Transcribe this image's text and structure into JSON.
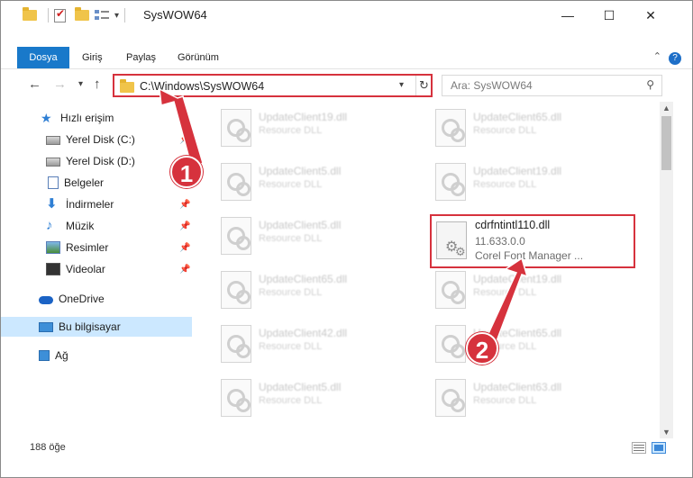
{
  "window": {
    "title": "SysWOW64"
  },
  "title_controls": {
    "minimize": "—",
    "maximize": "☐",
    "close": "✕",
    "qa_dropdown": "▾"
  },
  "ribbon": {
    "tabs": [
      "Dosya",
      "Giriş",
      "Paylaş",
      "Görünüm"
    ],
    "help": "?",
    "collapse": "⌃"
  },
  "nav": {
    "back": "←",
    "forward": "→",
    "recent": "▾",
    "up": "↑",
    "address": "C:\\Windows\\SysWOW64",
    "address_dropdown": "▾",
    "refresh": "↻",
    "search_placeholder": "Ara: SysWOW64",
    "search_glyph": "⚲"
  },
  "sidebar": {
    "items": [
      {
        "label": "Hızlı erişim",
        "icon": "star-icon",
        "pinned": false
      },
      {
        "label": "Yerel Disk (C:)",
        "icon": "drive-icon",
        "pinned": true
      },
      {
        "label": "Yerel Disk (D:)",
        "icon": "drive-icon",
        "pinned": true
      },
      {
        "label": "Belgeler",
        "icon": "documents-icon",
        "pinned": true
      },
      {
        "label": "İndirmeler",
        "icon": "download-icon",
        "pinned": true
      },
      {
        "label": "Müzik",
        "icon": "music-icon",
        "pinned": true
      },
      {
        "label": "Resimler",
        "icon": "pictures-icon",
        "pinned": true
      },
      {
        "label": "Videolar",
        "icon": "videos-icon",
        "pinned": true
      },
      {
        "label": "OneDrive",
        "icon": "cloud-icon",
        "pinned": false
      },
      {
        "label": "Bu bilgisayar",
        "icon": "computer-icon",
        "pinned": false,
        "selected": true
      },
      {
        "label": "Ağ",
        "icon": "network-icon",
        "pinned": false
      }
    ],
    "pin_glyph": "📌"
  },
  "files": [
    {
      "name": "UpdateClient19.dll",
      "desc": "Resource DLL"
    },
    {
      "name": "UpdateClient65.dll",
      "desc": "Resource DLL"
    },
    {
      "name": "UpdateClient5.dll",
      "desc": "Resource DLL"
    },
    {
      "name": "UpdateClient19.dll",
      "desc": "Resource DLL"
    },
    {
      "name": "UpdateClient5.dll",
      "desc": "Resource DLL"
    },
    {
      "name": "UpdateClient65.dll",
      "desc": "Resource DLL"
    },
    {
      "name": "UpdateClient19.dll",
      "desc": "Resource DLL"
    },
    {
      "name": "UpdateClient42.dll",
      "desc": "Resource DLL"
    },
    {
      "name": "UpdateClient65.dll",
      "desc": "Resource DLL"
    },
    {
      "name": "UpdateClient5.dll",
      "desc": "Resource DLL"
    },
    {
      "name": "UpdateClient63.dll",
      "desc": "Resource DLL"
    }
  ],
  "highlighted_file": {
    "name": "cdrfntintl110.dll",
    "version": "11.633.0.0",
    "description": "Corel Font Manager ..."
  },
  "status": {
    "item_count": "188 öğe"
  },
  "callouts": {
    "step1": "1",
    "step2": "2"
  },
  "scroll": {
    "up": "▲",
    "down": "▼"
  },
  "colors": {
    "accent": "#1979ca",
    "highlight": "#d6323d",
    "selected": "#cce8ff"
  }
}
